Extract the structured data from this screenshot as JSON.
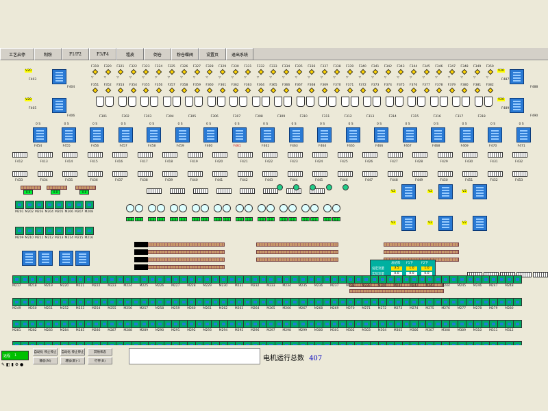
{
  "tabs": [
    "工艺启停",
    "制粉",
    "F1/F2",
    "F3/F4",
    "粗皮",
    "倒仓",
    "粉仓蝶阀",
    "设置页",
    "退出系统"
  ],
  "selected_tab": "工艺启停",
  "row1_labels": [
    "F319",
    "F320",
    "F321",
    "F322",
    "F323",
    "F324",
    "F325",
    "F326",
    "F327",
    "F328",
    "F329",
    "F330",
    "F331",
    "F332",
    "F333",
    "F334",
    "F335",
    "F336",
    "F337",
    "F338",
    "F339",
    "F340",
    "F341",
    "F342",
    "F343",
    "F344",
    "F345",
    "F346",
    "F347",
    "F348",
    "F349",
    "F350"
  ],
  "row2_labels": [
    "F351",
    "F352",
    "F353",
    "F354",
    "F355",
    "F356",
    "F357",
    "F358",
    "F359",
    "F360",
    "F361",
    "F362",
    "F363",
    "F364",
    "F365",
    "F366",
    "F367",
    "F368",
    "F369",
    "F370",
    "F371",
    "F372",
    "F373",
    "F374",
    "F375",
    "F376",
    "F377",
    "F378",
    "F379",
    "F380",
    "F381",
    "F382"
  ],
  "row3_labels": [
    "F301",
    "F302",
    "F303",
    "F304",
    "F305",
    "F306",
    "F307",
    "F308",
    "F309",
    "F310",
    "F311",
    "F312",
    "F313",
    "F314",
    "F315",
    "F316",
    "F317",
    "F318"
  ],
  "bin_labels": [
    "F454",
    "F455",
    "F456",
    "F457",
    "F458",
    "F459",
    "F460",
    "F461",
    "F462",
    "F463",
    "F464",
    "F465",
    "F466",
    "F467",
    "F468",
    "F469",
    "F470",
    "F471"
  ],
  "bin_alarm_label": "F461",
  "screw_row_a": [
    "F412",
    "F413",
    "F414",
    "F415",
    "F416",
    "F417",
    "F418",
    "F419",
    "F420",
    "F421",
    "F422",
    "F423",
    "F424",
    "F425",
    "F426",
    "F427",
    "F428",
    "F429",
    "F430",
    "F431",
    "F432"
  ],
  "screw_row_b": [
    "F433",
    "F434",
    "F435",
    "F436",
    "F437",
    "F438",
    "F439",
    "F440",
    "F441",
    "F442",
    "F443",
    "F444",
    "F445",
    "F446",
    "F447",
    "F448",
    "F449",
    "F450",
    "F451",
    "F452",
    "F453"
  ],
  "left_tags": {
    "v1": "V20",
    "v2": "V20",
    "f1": "F403",
    "f2": "F404",
    "f3": "F405",
    "f4": "F406"
  },
  "right_tags": {
    "v1": "V20",
    "v2": "V20",
    "f1": "F487",
    "f2": "F488",
    "f3": "F489",
    "f4": "F490"
  },
  "motor_row1": [
    "M217",
    "M218",
    "M219",
    "M220",
    "M221",
    "M222",
    "M223",
    "M224",
    "M225",
    "M226",
    "M227",
    "M228",
    "M229",
    "M230",
    "M231",
    "M232",
    "M233",
    "M234",
    "M235",
    "M236",
    "M237",
    "M238",
    "M239",
    "M240",
    "M241",
    "M242",
    "M243",
    "M244",
    "M245",
    "M246",
    "M247",
    "M248"
  ],
  "motor_row2": [
    "M249",
    "M250",
    "M251",
    "M252",
    "M253",
    "M254",
    "M255",
    "M256",
    "M257",
    "M258",
    "M259",
    "M260",
    "M261",
    "M262",
    "M263",
    "M264",
    "M265",
    "M266",
    "M267",
    "M268",
    "M269",
    "M270",
    "M271",
    "M272",
    "M273",
    "M274",
    "M275",
    "M276",
    "M277",
    "M278",
    "M279",
    "M280"
  ],
  "motor_row3": [
    "M281",
    "M282",
    "M283",
    "M284",
    "M285",
    "M286",
    "M287",
    "M288",
    "M289",
    "M290",
    "M291",
    "M292",
    "M293",
    "M294",
    "M295",
    "M296",
    "M297",
    "M298",
    "M299",
    "M300",
    "M301",
    "M302",
    "M303",
    "M304",
    "M305",
    "M306",
    "M307",
    "M308",
    "M309",
    "M310",
    "M311",
    "M312"
  ],
  "motor_row4": [
    "M313",
    "M314",
    "M315",
    "M316",
    "M317",
    "M318",
    "M319",
    "M320",
    "M321",
    "M322",
    "M323",
    "M324",
    "M325",
    "M326",
    "M327",
    "M328",
    "M329",
    "M330",
    "M331",
    "M332",
    "M333",
    "M334",
    "M335",
    "M336",
    "M337",
    "M338",
    "M339",
    "M340",
    "M341",
    "M342",
    "M343",
    "M344"
  ],
  "left_motors": [
    "M201",
    "M202",
    "M203",
    "M204",
    "M205",
    "M206",
    "M207",
    "M208",
    "M209",
    "M210",
    "M211",
    "M212",
    "M213",
    "M214",
    "M215",
    "M216"
  ],
  "mid_labels": [
    "F443",
    "F407",
    "F408",
    "F409",
    "F410",
    "F411",
    "F481",
    "F482",
    "F483",
    "F484",
    "F485",
    "F486"
  ],
  "center_panel": {
    "headers": [
      "总给料",
      "F1下",
      "F2下"
    ],
    "rows": [
      {
        "label": "设定流量",
        "vals": [
          "3.5",
          "1.0",
          "1.0"
        ]
      },
      {
        "label": "实际流量",
        "vals": [
          "0.0",
          "0.0",
          "0.0"
        ]
      },
      {
        "label": "累计流量",
        "vals": [
          "0",
          "0",
          "0"
        ]
      }
    ]
  },
  "status": {
    "remote_label": "远程",
    "remote_value": "1",
    "buttons": [
      "自动化 停止停止",
      "自动化 停止停止",
      "其他状态",
      "静态(M)",
      "增加(新)-1",
      "行存(R)"
    ],
    "motor_count_label": "电机运行总数",
    "motor_count_value": "407"
  },
  "icons": [
    "pump-icon",
    "bin-icon",
    "motor-icon",
    "screw-conveyor-icon",
    "valve-icon",
    "fan-icon"
  ]
}
